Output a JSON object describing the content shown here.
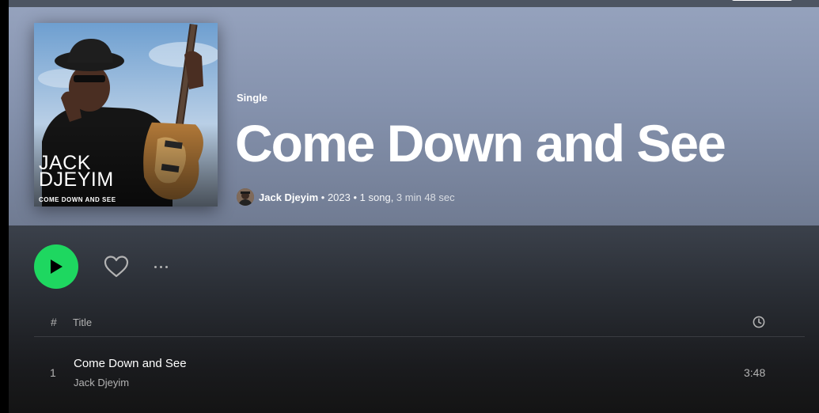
{
  "album": {
    "type": "Single",
    "title": "Come Down and See",
    "cover_title_line1": "JACK",
    "cover_title_line2": "DJEYIM",
    "cover_subtitle": "COME DOWN AND SEE"
  },
  "meta": {
    "artist": "Jack Djeyim",
    "sep1": " • ",
    "year": "2023",
    "sep2": " • ",
    "count": "1 song,",
    "duration": " 3 min 48 sec"
  },
  "controls": {
    "play_icon": "play-icon",
    "like_icon": "heart-icon",
    "more_icon": "more-icon"
  },
  "table": {
    "headers": {
      "number": "#",
      "title": "Title",
      "duration_icon": "clock-icon"
    },
    "rows": [
      {
        "number": "1",
        "title": "Come Down and See",
        "artist": "Jack Djeyim",
        "duration": "3:48"
      }
    ]
  },
  "colors": {
    "accent": "#1ed760",
    "hero_top": "#95a2bd",
    "hero_bottom": "#707b92",
    "background": "#121212",
    "muted_text": "#b3b3b3"
  }
}
